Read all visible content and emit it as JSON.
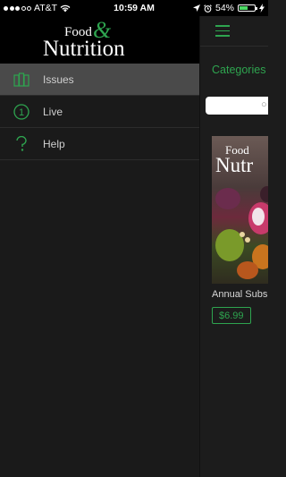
{
  "status_bar": {
    "carrier": "AT&T",
    "time": "10:59 AM",
    "battery_percent": "54%",
    "battery_level": 0.54,
    "signal_filled": 3,
    "signal_total": 5
  },
  "drawer": {
    "logo": {
      "top": "Food",
      "ampersand": "&",
      "main": "Nutrition"
    },
    "items": [
      {
        "label": "Issues",
        "icon": "magazines-icon",
        "active": true
      },
      {
        "label": "Live",
        "icon": "number-one-circle-icon",
        "active": false
      },
      {
        "label": "Help",
        "icon": "question-mark-icon",
        "active": false
      }
    ]
  },
  "content": {
    "categories_label": "Categories",
    "cover_title_top": "Food",
    "cover_title_main": "Nutr",
    "subscription_label": "Annual Subs",
    "price": "$6.99"
  },
  "colors": {
    "accent": "#2ea44f",
    "drawer_bg": "#1a1a1a",
    "active_item_bg": "#4a4a4a",
    "header_bg": "#000000"
  }
}
